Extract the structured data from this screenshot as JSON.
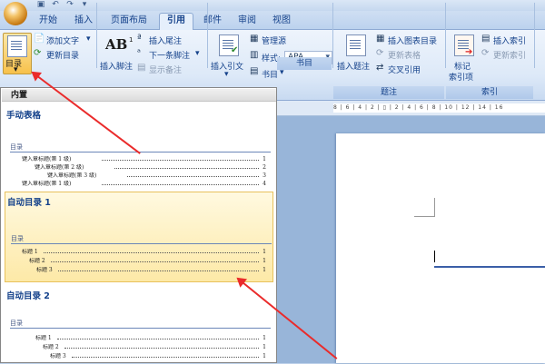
{
  "tabs": [
    "开始",
    "插入",
    "页面布局",
    "引用",
    "邮件",
    "审阅",
    "视图"
  ],
  "active_tab": "引用",
  "ribbon": {
    "toc_button": "目录",
    "add_text": "添加文字",
    "update_toc": "更新目录",
    "insert_footnote": "插入脚注",
    "insert_endnote": "插入尾注",
    "next_footnote": "下一条脚注",
    "show_notes": "显示备注",
    "ab_glyph": "AB",
    "insert_citation": "插入引文",
    "manage_sources": "管理源",
    "style_label": "样式:",
    "style_value": "APA",
    "bibliography": "书目",
    "group_citations_partial": "书目",
    "insert_caption": "插入题注",
    "insert_table_of_figures": "插入图表目录",
    "update_table": "更新表格",
    "cross_reference": "交叉引用",
    "group_captions": "题注",
    "mark_entry": "标记\n索引项",
    "mark_entry_line1": "标记",
    "mark_entry_line2": "索引项",
    "insert_index": "插入索引",
    "update_index": "更新索引",
    "group_index": "索引"
  },
  "dropdown": {
    "header": "内置",
    "manual": {
      "title": "手动表格",
      "heading": "目录",
      "entries": [
        {
          "text": "键入章标题(第 1 级)",
          "page": "1",
          "level": 1
        },
        {
          "text": "键入章标题(第 2 级)",
          "page": "2",
          "level": 2
        },
        {
          "text": "键入章标题(第 3 级)",
          "page": "3",
          "level": 3
        },
        {
          "text": "键入章标题(第 1 级)",
          "page": "4",
          "level": 1
        }
      ]
    },
    "auto1": {
      "title": "自动目录 1",
      "heading": "目录",
      "entries": [
        {
          "text": "标题 1",
          "page": "1",
          "level": 1
        },
        {
          "text": "标题 2",
          "page": "1",
          "level": 2
        },
        {
          "text": "标题 3",
          "page": "1",
          "level": 3
        }
      ]
    },
    "auto2": {
      "title": "自动目录 2",
      "heading": "目录",
      "entries": [
        {
          "text": "标题 1",
          "page": "1",
          "level": 1
        },
        {
          "text": "标题 2",
          "page": "1",
          "level": 2
        },
        {
          "text": "标题 3",
          "page": "1",
          "level": 3
        }
      ]
    }
  },
  "ruler_text": "8 | 6 | 4 | 2 | ▯ | 2 | 4 | 6 | 8 | 10 | 12 | 14 | 16",
  "colors": {
    "accent": "#15428b",
    "highlight": "#fde9a7",
    "annotation_arrow": "#ea2b2b"
  }
}
